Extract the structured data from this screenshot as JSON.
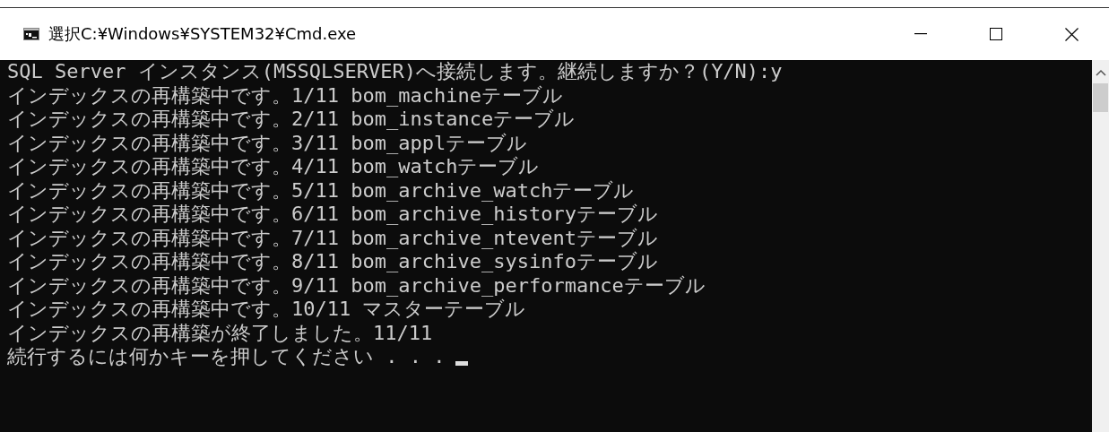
{
  "window": {
    "title": "選択C:¥Windows¥SYSTEM32¥Cmd.exe"
  },
  "console": {
    "lines": [
      "SQL Server インスタンス(MSSQLSERVER)へ接続します。継続しますか？(Y/N):y",
      "インデックスの再構築中です。1/11 bom_machineテーブル",
      "インデックスの再構築中です。2/11 bom_instanceテーブル",
      "インデックスの再構築中です。3/11 bom_applテーブル",
      "インデックスの再構築中です。4/11 bom_watchテーブル",
      "インデックスの再構築中です。5/11 bom_archive_watchテーブル",
      "インデックスの再構築中です。6/11 bom_archive_historyテーブル",
      "インデックスの再構築中です。7/11 bom_archive_nteventテーブル",
      "インデックスの再構築中です。8/11 bom_archive_sysinfoテーブル",
      "インデックスの再構築中です。9/11 bom_archive_performanceテーブル",
      "インデックスの再構築中です。10/11 マスターテーブル",
      "インデックスの再構築が終了しました。11/11",
      "続行するには何かキーを押してください . . ."
    ],
    "cursor_shown": true
  }
}
